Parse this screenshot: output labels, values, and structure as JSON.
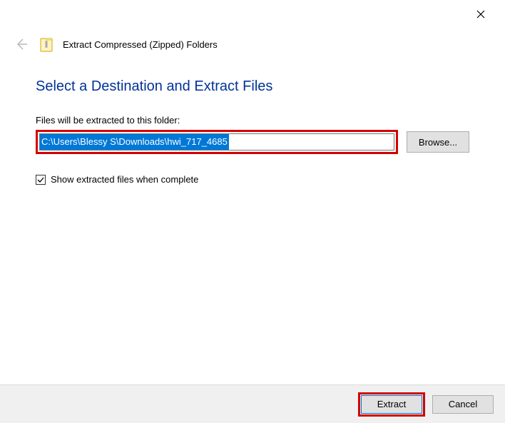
{
  "window": {
    "title": "Extract Compressed (Zipped) Folders"
  },
  "main": {
    "heading": "Select a Destination and Extract Files",
    "dest_label": "Files will be extracted to this folder:",
    "dest_path": "C:\\Users\\Blessy S\\Downloads\\hwi_717_4685",
    "browse_label": "Browse...",
    "show_files_label": "Show extracted files when complete",
    "show_files_checked": true
  },
  "footer": {
    "extract_label": "Extract",
    "cancel_label": "Cancel"
  }
}
